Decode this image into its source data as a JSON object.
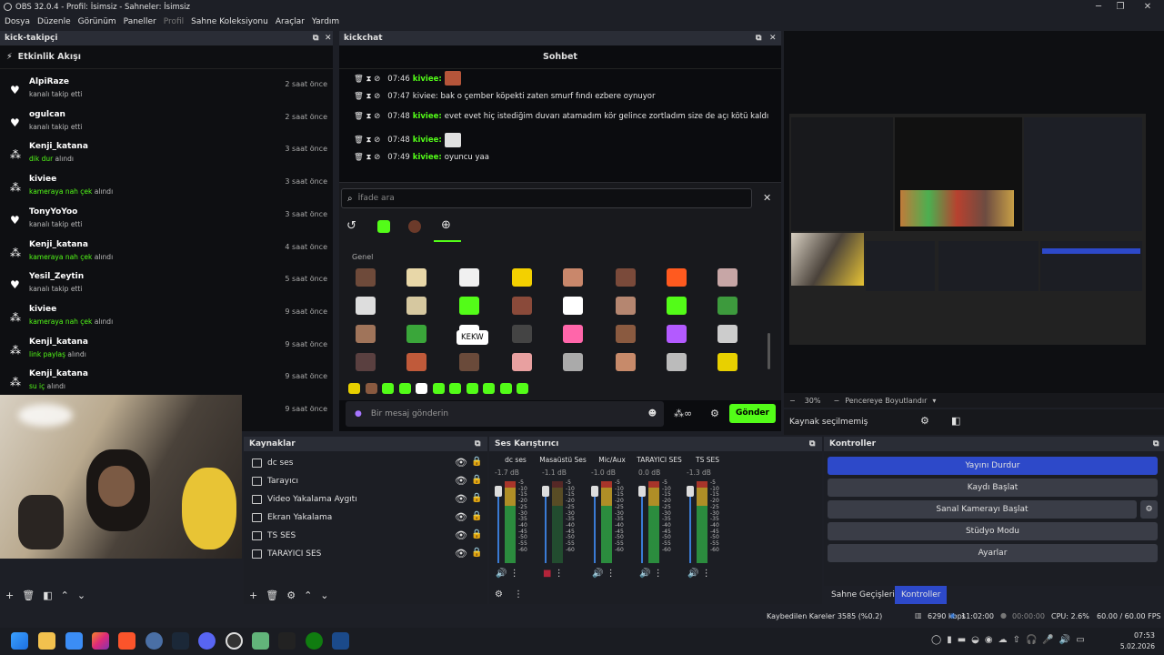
{
  "window": {
    "title": "OBS 32.0.4 - Profil: İsimsiz - Sahneler: İsimsiz"
  },
  "menu": [
    "Dosya",
    "Düzenle",
    "Görünüm",
    "Paneller",
    "Profil",
    "Sahne Koleksiyonu",
    "Araçlar",
    "Yardım"
  ],
  "left_dock": {
    "title": "kick-takipçi",
    "header": "Etkinlik Akışı",
    "events": [
      {
        "user": "AlpiRaze",
        "action": "kanalı takip etti",
        "highlight": "",
        "suffix": "",
        "time": "2 saat önce",
        "icon": "heart"
      },
      {
        "user": "ogulcan",
        "action": "kanalı takip etti",
        "highlight": "",
        "suffix": "",
        "time": "2 saat önce",
        "icon": "heart"
      },
      {
        "user": "Kenji_katana",
        "action": "",
        "highlight": "dik dur",
        "suffix": " alındı",
        "time": "3 saat önce",
        "icon": "points"
      },
      {
        "user": "kiviee",
        "action": "",
        "highlight": "kameraya nah çek",
        "suffix": " alındı",
        "time": "3 saat önce",
        "icon": "points"
      },
      {
        "user": "TonyYoYoo",
        "action": "kanalı takip etti",
        "highlight": "",
        "suffix": "",
        "time": "3 saat önce",
        "icon": "heart"
      },
      {
        "user": "Kenji_katana",
        "action": "",
        "highlight": "kameraya nah çek",
        "suffix": " alındı",
        "time": "4 saat önce",
        "icon": "points"
      },
      {
        "user": "Yesil_Zeytin",
        "action": "kanalı takip etti",
        "highlight": "",
        "suffix": "",
        "time": "5 saat önce",
        "icon": "heart"
      },
      {
        "user": "kiviee",
        "action": "",
        "highlight": "kameraya nah çek",
        "suffix": " alındı",
        "time": "9 saat önce",
        "icon": "points"
      },
      {
        "user": "Kenji_katana",
        "action": "",
        "highlight": "link paylaş",
        "suffix": " alındı",
        "time": "9 saat önce",
        "icon": "points"
      },
      {
        "user": "Kenji_katana",
        "action": "",
        "highlight": "su iç",
        "suffix": " alındı",
        "time": "9 saat önce",
        "icon": "points"
      },
      {
        "user": "",
        "action": "",
        "highlight": "",
        "suffix": "",
        "time": "9 saat önce",
        "icon": "points"
      }
    ]
  },
  "chat": {
    "dock_title": "kickchat",
    "header": "Sohbet",
    "messages": [
      {
        "time": "07:46",
        "user": "kiviee:",
        "text": "",
        "emote": true
      },
      {
        "time": "07:47",
        "user": "",
        "text": "kiviee: bak o çember köpekti zaten smurf fındı ezbere oynuyor",
        "emote": false
      },
      {
        "time": "07:48",
        "user": "kiviee:",
        "text": "evet evet hiç istediğim duvarı atamadım kör gelince zortladım size de açı kötü kaldı",
        "emote": false
      },
      {
        "time": "07:48",
        "user": "kiviee:",
        "text": "",
        "emote": true
      },
      {
        "time": "07:49",
        "user": "kiviee:",
        "text": "oyuncu yaa",
        "emote": false
      }
    ],
    "search_placeholder": "İfade ara",
    "section": "Genel",
    "tooltip": "KEKW",
    "input_placeholder": "Bir mesaj gönderin",
    "send": "Gönder"
  },
  "preview": {
    "zoom": "30%",
    "fit": "Pencereye Boyutlandır",
    "no_source": "Kaynak seçilmemiş"
  },
  "sources": {
    "title": "Kaynaklar",
    "items": [
      "dc ses",
      "Tarayıcı",
      "Video Yakalama Aygıtı",
      "Ekran Yakalama",
      "TS SES",
      "TARAYICI SES"
    ]
  },
  "mixer": {
    "title": "Ses Karıştırıcı",
    "channels": [
      {
        "name": "dc ses",
        "db": "-1.7 dB"
      },
      {
        "name": "Masaüstü Ses",
        "db": "-1.1 dB"
      },
      {
        "name": "Mic/Aux",
        "db": "-1.0 dB"
      },
      {
        "name": "TARAYICI SES",
        "db": "0.0 dB"
      },
      {
        "name": "TS SES",
        "db": "-1.3 dB"
      }
    ],
    "scale": [
      "-5",
      "-10",
      "-15",
      "-20",
      "-25",
      "-30",
      "-35",
      "-40",
      "-45",
      "-50",
      "-55",
      "-60"
    ]
  },
  "controls": {
    "title": "Kontroller",
    "stop_stream": "Yayını Durdur",
    "start_record": "Kaydı Başlat",
    "virtual_cam": "Sanal Kamerayı Başlat",
    "studio": "Stüdyo Modu",
    "settings": "Ayarlar",
    "tab_transitions": "Sahne Geçişleri",
    "tab_controls": "Kontroller"
  },
  "status": {
    "dropped": "Kaybedilen Kareler 3585 (%0.2)",
    "bitrate": "6290 kbps",
    "stream_time": "11:02:00",
    "rec_time": "00:00:00",
    "cpu": "CPU: 2.6%",
    "fps": "60.00 / 60.00 FPS"
  },
  "taskbar": {
    "time": "07:53",
    "date": "5.02.2026"
  },
  "colors": {
    "accent": "#53fc18",
    "primary_button": "#2d49c9",
    "tab_active": "#2d49c9"
  }
}
